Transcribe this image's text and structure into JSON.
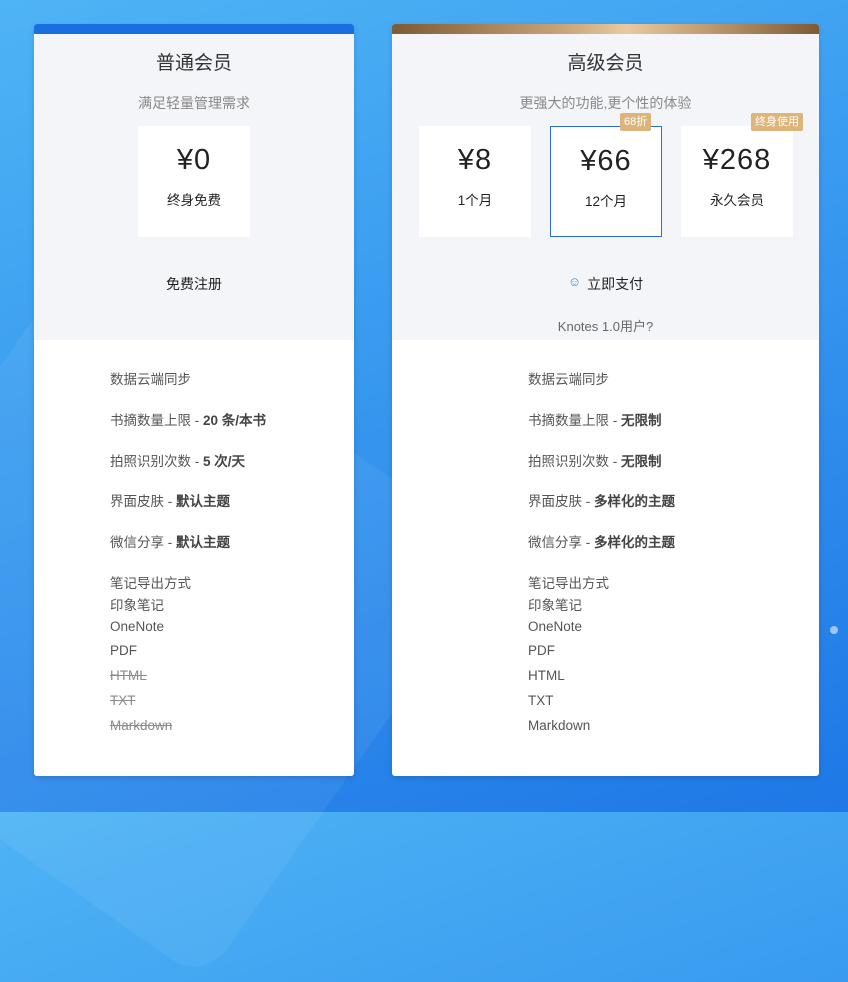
{
  "basic": {
    "title": "普通会员",
    "subtitle": "满足轻量管理需求",
    "plan": {
      "price": "¥0",
      "period": "终身免费"
    },
    "action": "免费注册",
    "features": {
      "sync": "数据云端同步",
      "excerpt_label": "书摘数量上限 - ",
      "excerpt_value": "20 条/本书",
      "ocr_label": "拍照识别次数 - ",
      "ocr_value": "5 次/天",
      "skin_label": "界面皮肤 - ",
      "skin_value": "默认主题",
      "share_label": "微信分享 - ",
      "share_value": "默认主题",
      "export_title": "笔记导出方式",
      "export": [
        "印象笔记",
        "OneNote",
        "PDF",
        "HTML",
        "TXT",
        "Markdown"
      ]
    }
  },
  "pro": {
    "title": "高级会员",
    "subtitle": "更强大的功能,更个性的体验",
    "plans": [
      {
        "price": "¥8",
        "period": "1个月"
      },
      {
        "price": "¥66",
        "period": "12个月",
        "tag": "68折"
      },
      {
        "price": "¥268",
        "period": "永久会员",
        "tag": "终身使用"
      }
    ],
    "action": "立即支付",
    "legacy": "Knotes 1.0用户?",
    "features": {
      "sync": "数据云端同步",
      "excerpt_label": "书摘数量上限 - ",
      "excerpt_value": "无限制",
      "ocr_label": "拍照识别次数 - ",
      "ocr_value": "无限制",
      "skin_label": "界面皮肤 - ",
      "skin_value": "多样化的主题",
      "share_label": "微信分享 - ",
      "share_value": "多样化的主题",
      "export_title": "笔记导出方式",
      "export": [
        "印象笔记",
        "OneNote",
        "PDF",
        "HTML",
        "TXT",
        "Markdown"
      ]
    }
  },
  "colors": {
    "accent": "#1a6fe0",
    "gold": "#ddb47a",
    "selected_border": "#2a6fd6"
  }
}
